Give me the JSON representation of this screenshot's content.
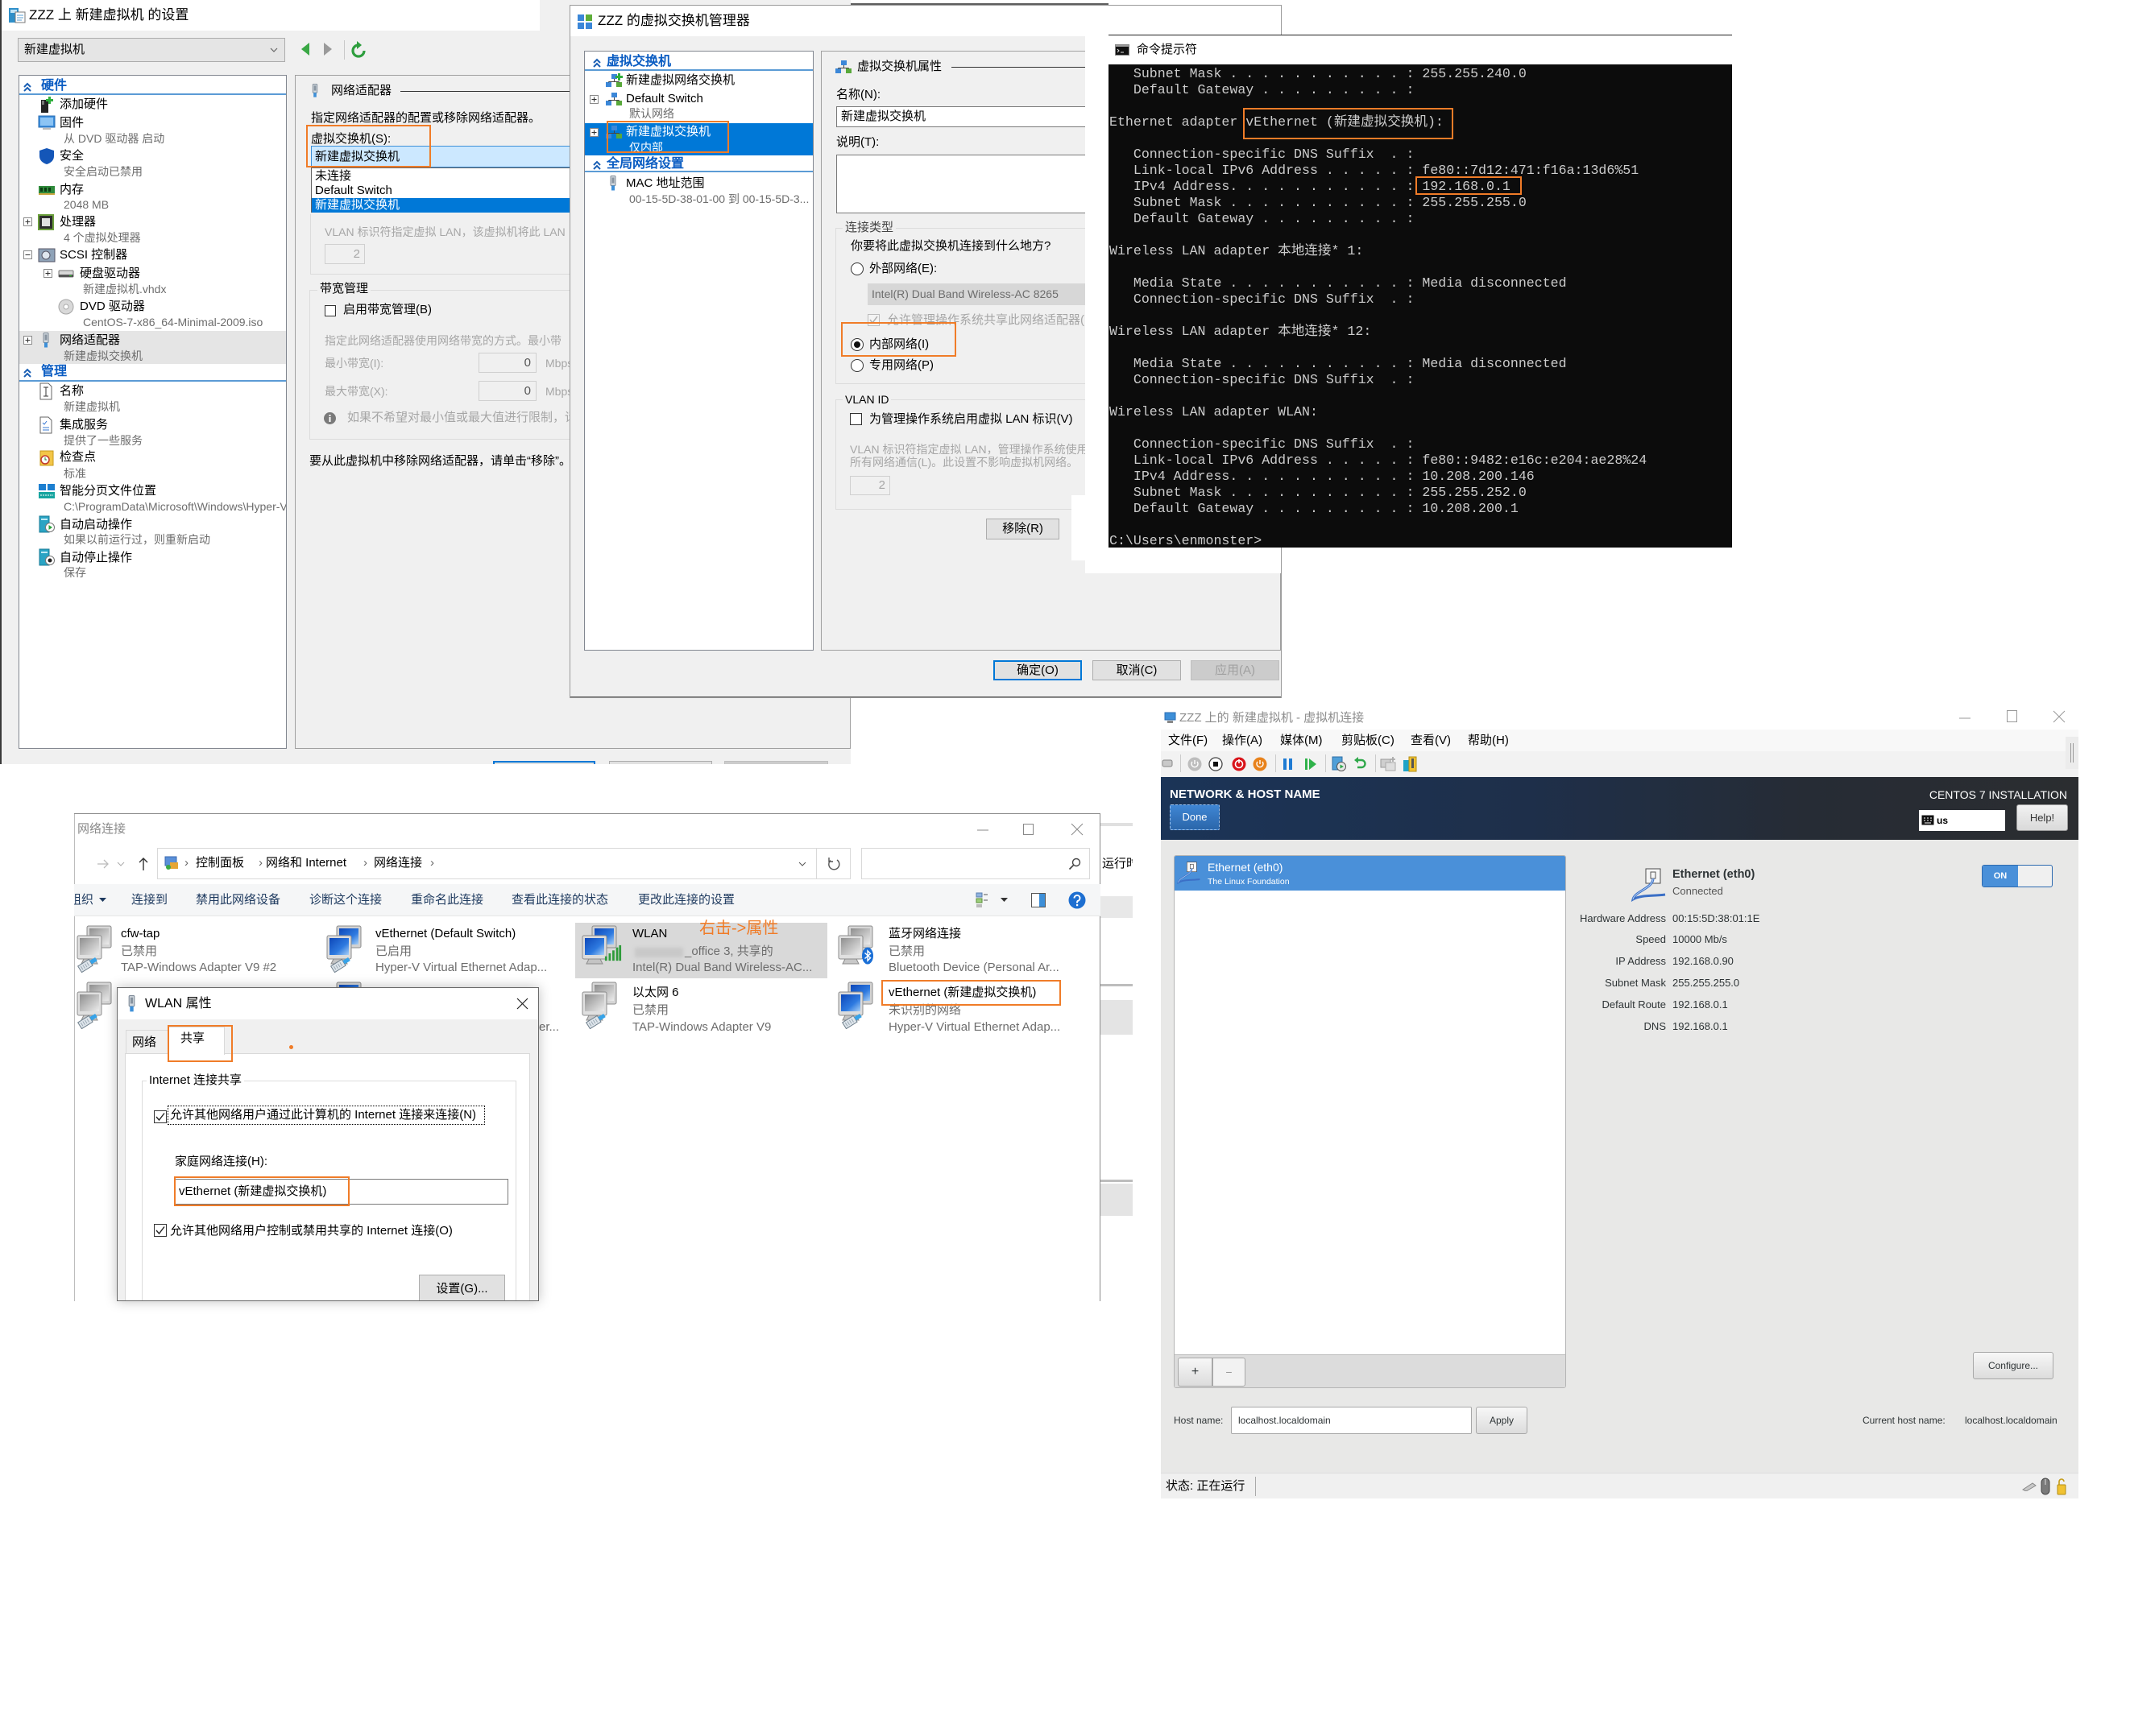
{
  "theme": {
    "annotation": "#f07c28",
    "accent": "#0078d7",
    "tree_header": "#0a5cc2",
    "centos_blue": "#4a90d9",
    "cmd_text": "#cccccc",
    "cmd_bg": "#0c0c0c"
  },
  "settings": {
    "title": "ZZZ 上 新建虚拟机 的设置",
    "vm_select": "新建虚拟机",
    "tree": {
      "hardware_header": "硬件",
      "hardware": [
        {
          "label": "添加硬件"
        },
        {
          "label": "固件",
          "sub": "从 DVD 驱动器 启动"
        },
        {
          "label": "安全",
          "sub": "安全启动已禁用"
        },
        {
          "label": "内存",
          "sub": "2048 MB"
        },
        {
          "label": "处理器",
          "sub": "4 个虚拟处理器"
        },
        {
          "label": "SCSI 控制器"
        },
        {
          "label": "硬盘驱动器",
          "sub": "新建虚拟机.vhdx"
        },
        {
          "label": "DVD 驱动器",
          "sub": "CentOS-7-x86_64-Minimal-2009.iso"
        },
        {
          "label": "网络适配器",
          "sub": "新建虚拟交换机",
          "selected": true
        }
      ],
      "management_header": "管理",
      "management": [
        {
          "label": "名称",
          "sub": "新建虚拟机"
        },
        {
          "label": "集成服务",
          "sub": "提供了一些服务"
        },
        {
          "label": "检查点",
          "sub": "标准"
        },
        {
          "label": "智能分页文件位置",
          "sub": "C:\\ProgramData\\Microsoft\\Windows\\Hyper-V"
        },
        {
          "label": "自动启动操作",
          "sub": "如果以前运行过，则重新启动"
        },
        {
          "label": "自动停止操作",
          "sub": "保存"
        }
      ]
    },
    "adapter": {
      "section_title": "网络适配器",
      "description": "指定网络适配器的配置或移除网络适配器。",
      "switch_label": "虚拟交换机(S):",
      "switch_value": "新建虚拟交换机",
      "switch_options": [
        "未连接",
        "Default Switch",
        "新建虚拟交换机"
      ],
      "switch_highlighted": "新建虚拟交换机",
      "vlan_hint": "VLAN 标识符指定虚拟 LAN，该虚拟机将此 LAN",
      "vlan_id": "2",
      "bandwidth_group": "带宽管理",
      "bandwidth_enable": "启用带宽管理(B)",
      "bandwidth_enabled": false,
      "bandwidth_hint": "指定此网络适配器使用网络带宽的方式。最小带",
      "min_label": "最小带宽(I):",
      "min_value": "0",
      "max_label": "最大带宽(X):",
      "max_value": "0",
      "unit": "Mbps",
      "info_text": "如果不希望对最小值或最大值进行限制，请",
      "remove_hint": "要从此虚拟机中移除网络适配器，请单击“移除”。"
    }
  },
  "switch_manager": {
    "title": "ZZZ 的虚拟交换机管理器",
    "tree": {
      "switches_header": "虚拟交换机",
      "new_switch": "新建虚拟网络交换机",
      "switches": [
        {
          "name": "Default Switch",
          "type": "默认网络"
        },
        {
          "name": "新建虚拟交换机",
          "type": "仅内部",
          "selected": true
        }
      ],
      "global_header": "全局网络设置",
      "mac_range_label": "MAC 地址范围",
      "mac_range_value": "00-15-5D-38-01-00 到 00-15-5D-3..."
    },
    "props": {
      "section_title": "虚拟交换机属性",
      "name_label": "名称(N):",
      "name_value": "新建虚拟交换机",
      "notes_label": "说明(T):",
      "conn_group": "连接类型",
      "conn_question": "你要将此虚拟交换机连接到什么地方?",
      "external_label": "外部网络(E):",
      "external_adapter": "Intel(R) Dual Band Wireless-AC 8265",
      "allow_mgmt_share": "允许管理操作系统共享此网络适配器(M)",
      "internal_label": "内部网络(I)",
      "private_label": "专用网络(P)",
      "selected_connection_type": "内部网络(I)",
      "vlan_group": "VLAN ID",
      "vlan_enable": "为管理操作系统启用虚拟 LAN 标识(V)",
      "vlan_hint_1": "VLAN 标识符指定虚拟 LAN，管理操作系统使用",
      "vlan_hint_2": "所有网络通信(L)。此设置不影响虚拟机网络。",
      "vlan_id": "2",
      "remove_button": "移除(R)"
    },
    "buttons": {
      "ok": "确定(O)",
      "cancel": "取消(C)",
      "apply": "应用(A)"
    }
  },
  "cmd": {
    "title": "命令提示符",
    "lines": [
      "   Subnet Mask . . . . . . . . . . . : 255.255.240.0",
      "   Default Gateway . . . . . . . . . :",
      "",
      "Ethernet adapter vEthernet (新建虚拟交换机):",
      "",
      "   Connection-specific DNS Suffix  . :",
      "   Link-local IPv6 Address . . . . . : fe80::7d12:471:f16a:13d6%51",
      "   IPv4 Address. . . . . . . . . . . : 192.168.0.1",
      "   Subnet Mask . . . . . . . . . . . : 255.255.255.0",
      "   Default Gateway . . . . . . . . . :",
      "",
      "Wireless LAN adapter 本地连接* 1:",
      "",
      "   Media State . . . . . . . . . . . : Media disconnected",
      "   Connection-specific DNS Suffix  . :",
      "",
      "Wireless LAN adapter 本地连接* 12:",
      "",
      "   Media State . . . . . . . . . . . : Media disconnected",
      "   Connection-specific DNS Suffix  . :",
      "",
      "Wireless LAN adapter WLAN:",
      "",
      "   Connection-specific DNS Suffix  . :",
      "   Link-local IPv6 Address . . . . . : fe80::9482:e16c:e204:ae28%24",
      "   IPv4 Address. . . . . . . . . . . : 10.208.200.146",
      "   Subnet Mask . . . . . . . . . . . : 255.255.252.0",
      "   Default Gateway . . . . . . . . . : 10.208.200.1",
      "",
      "C:\\Users\\enmonster>"
    ]
  },
  "network_connections": {
    "title": "网络连接",
    "breadcrumb": [
      "控制面板",
      "网络和 Internet",
      "网络连接"
    ],
    "search_value": "",
    "toolbar": [
      "组织",
      "连接到",
      "禁用此网络设备",
      "诊断这个连接",
      "重命名此连接",
      "查看此连接的状态",
      "更改此连接的设置"
    ],
    "connections": [
      {
        "name": "cfw-tap",
        "status": "已禁用",
        "device": "TAP-Windows Adapter V9 #2"
      },
      {
        "name": "vEthernet (Default Switch)",
        "status": "已启用",
        "device": "Hyper-V Virtual Ethernet Adap..."
      },
      {
        "name": "WLAN",
        "status": "_office 3, 共享的",
        "device": "Intel(R) Dual Band Wireless-AC...",
        "selected": true
      },
      {
        "name": "蓝牙网络连接",
        "status": "已禁用",
        "device": "Bluetooth Device (Personal Ar..."
      },
      {
        "name": "以太网 6",
        "status": "已禁用",
        "device": "TAP-Windows Adapter V9"
      },
      {
        "name": "vEthernet (新建虚拟交换机)",
        "status": "未识别的网络",
        "device": "Hyper-V Virtual Ethernet Adap..."
      }
    ],
    "hidden_item_text": "er..."
  },
  "background_window": {
    "text": "运行时"
  },
  "wlan_properties": {
    "title": "WLAN 属性",
    "tabs": [
      "网络",
      "共享"
    ],
    "active_tab": "共享",
    "group": "Internet 连接共享",
    "allow_share": "允许其他网络用户通过此计算机的 Internet 连接来连接(N)",
    "allow_share_checked": true,
    "home_label": "家庭网络连接(H):",
    "home_value": "vEthernet (新建虚拟交换机)",
    "allow_control": "允许其他网络用户控制或禁用共享的 Internet 连接(O)",
    "allow_control_checked": true,
    "settings_button": "设置(G)..."
  },
  "vm_connection": {
    "title": "ZZZ 上的 新建虚拟机 - 虚拟机连接",
    "menu": [
      "文件(F)",
      "操作(A)",
      "媒体(M)",
      "剪贴板(C)",
      "查看(V)",
      "帮助(H)"
    ],
    "installer": {
      "screen_title": "NETWORK & HOST NAME",
      "done_button": "Done",
      "product": "CENTOS 7 INSTALLATION",
      "keyboard_layout": "us",
      "help_button": "Help!",
      "devices": [
        {
          "name": "Ethernet (eth0)",
          "vendor": "The Linux Foundation",
          "selected": true
        }
      ],
      "detail": {
        "name": "Ethernet (eth0)",
        "state": "Connected",
        "toggle": "ON",
        "fields": [
          {
            "label": "Hardware Address",
            "value": "00:15:5D:38:01:1E"
          },
          {
            "label": "Speed",
            "value": "10000 Mb/s"
          },
          {
            "label": "IP Address",
            "value": "192.168.0.90"
          },
          {
            "label": "Subnet Mask",
            "value": "255.255.255.0"
          },
          {
            "label": "Default Route",
            "value": "192.168.0.1"
          },
          {
            "label": "DNS",
            "value": "192.168.0.1"
          }
        ]
      },
      "add_button": "+",
      "remove_button": "−",
      "configure_button": "Configure...",
      "host_name_label": "Host name:",
      "host_name_value": "localhost.localdomain",
      "apply_button": "Apply",
      "current_host_label": "Current host name:",
      "current_host_value": "localhost.localdomain"
    },
    "status": "状态: 正在运行"
  },
  "annotations": {
    "right_click_hint": "右击->属性"
  }
}
